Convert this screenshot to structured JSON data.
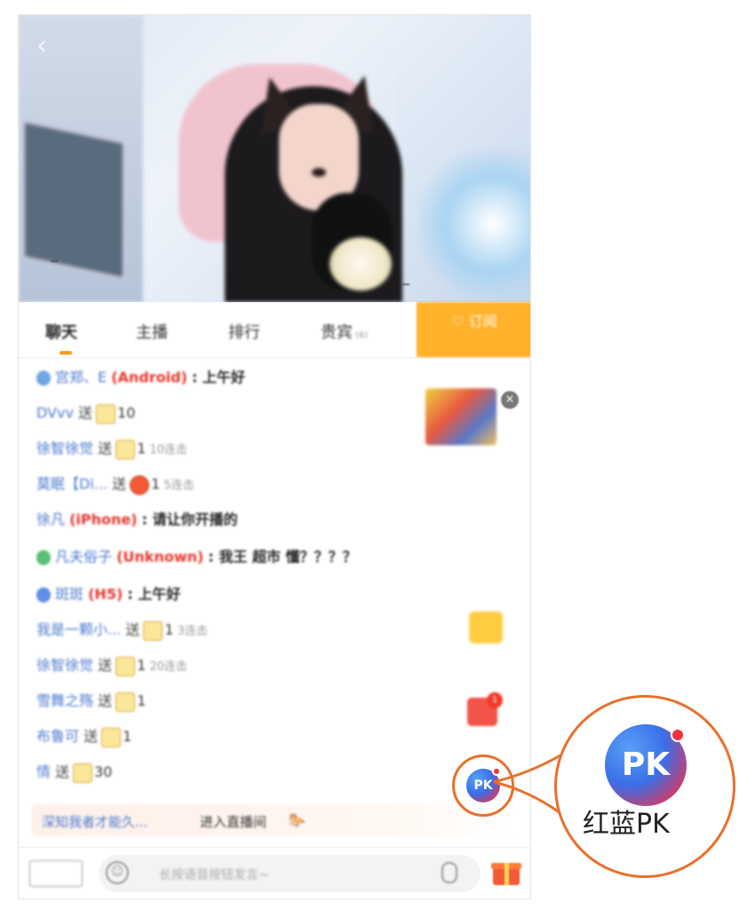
{
  "video": {
    "title_overlay": "",
    "tag_left": "",
    "tag_right": ""
  },
  "tabs": [
    {
      "label": "聊天",
      "active": true
    },
    {
      "label": "主播",
      "active": false
    },
    {
      "label": "排行",
      "active": false
    },
    {
      "label": "贵宾",
      "active": false,
      "count": "(6)"
    }
  ],
  "subscribe": {
    "label": "订阅",
    "sub": ""
  },
  "chat": {
    "messages": [
      {
        "badge": "",
        "badge_color": "#6fa6e6",
        "user": "宫郑、E",
        "device": "(Android)",
        "text": "上午好"
      },
      {
        "user": "DVvv",
        "verb": "送",
        "gift": "yellow",
        "count": "10"
      },
      {
        "user": "徐智徐觉",
        "verb": "送",
        "gift": "yellow",
        "count": "1",
        "combo": "10连击"
      },
      {
        "user": "莫眠【Di...",
        "verb": "送",
        "gift": "red",
        "count": "1",
        "combo": "5连击"
      },
      {
        "user": "徐凡",
        "device": "(iPhone)",
        "text": "请让你开播的"
      },
      {
        "badge": "",
        "badge_color": "#5bbf7a",
        "user": "凡夫俗子",
        "device": "(Unknown)",
        "text": "我王 超市 懂？？？？"
      },
      {
        "badge": "",
        "badge_color": "#5f90e8",
        "user": "斑斑",
        "device": "(H5)",
        "text": "上午好"
      },
      {
        "user": "我是一颗小...",
        "verb": "送",
        "gift": "yellow",
        "count": "1",
        "combo": "3连击"
      },
      {
        "user": "徐智徐觉",
        "verb": "送",
        "gift": "yellow",
        "count": "1",
        "combo": "20连击"
      },
      {
        "user": "雪舞之殇",
        "verb": "送",
        "gift": "yellow",
        "count": "1"
      },
      {
        "user": "布鲁可",
        "verb": "送",
        "gift": "yellow",
        "count": "1"
      },
      {
        "user": "情",
        "verb": "送",
        "gift": "yellow",
        "count": "30"
      }
    ],
    "enter": {
      "user": "深知我者才能久...",
      "text": "进入直播间"
    }
  },
  "floaters": {
    "ad_close": "×",
    "gift_badge": "1",
    "pk_small_text": "PK"
  },
  "bottom": {
    "logo_text": "",
    "input_placeholder": "长按语音按钮发言~"
  },
  "callout": {
    "icon_text": "PK",
    "label": "红蓝PK"
  },
  "colors": {
    "accent_orange": "#e8702c",
    "subscribe_bg": "#ffb12b",
    "username_blue": "#4c7ad0",
    "device_red": "#e8342b"
  }
}
